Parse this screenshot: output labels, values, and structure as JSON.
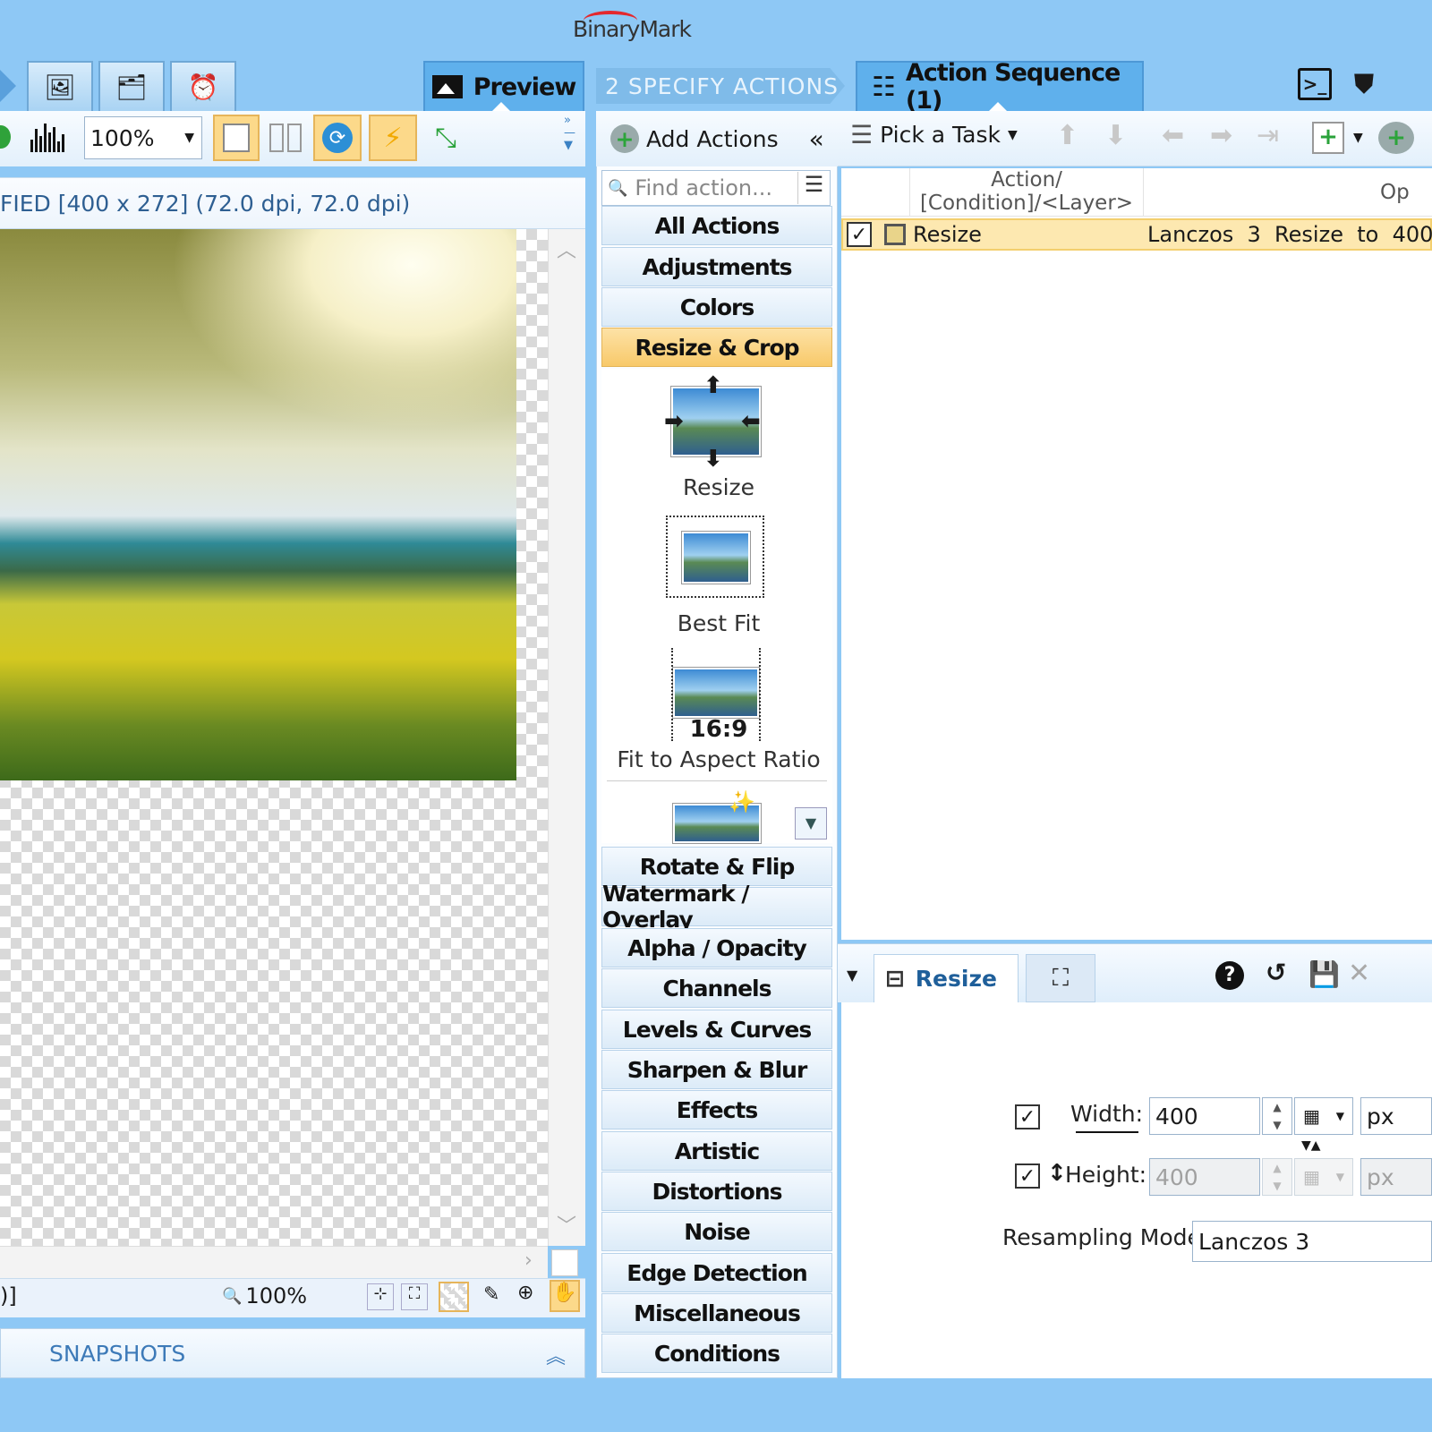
{
  "app": {
    "brand": "BinaryMark"
  },
  "tabs": {
    "preview": "Preview",
    "step2": "2  SPECIFY ACTIONS",
    "action_sequence": "Action Sequence (1)"
  },
  "left_toolbar": {
    "zoom_value": "100%"
  },
  "image_info": "FIED [400 x 272] (72.0 dpi, 72.0 dpi)",
  "status_bar": {
    "left_fragment": ")]",
    "zoom": "100%"
  },
  "snapshots": {
    "label": "SNAPSHOTS"
  },
  "actions_panel": {
    "add_actions": "Add Actions",
    "search_placeholder": "Find action...",
    "categories_top": [
      "All Actions",
      "Adjustments",
      "Colors",
      "Resize & Crop"
    ],
    "resize_items": [
      "Resize",
      "Best Fit",
      "Fit to Aspect Ratio"
    ],
    "aspect_ratio_label": "16:9",
    "categories_bottom": [
      "Rotate & Flip",
      "Watermark / Overlay",
      "Alpha / Opacity",
      "Channels",
      "Levels & Curves",
      "Sharpen & Blur",
      "Effects",
      "Artistic",
      "Distortions",
      "Noise",
      "Edge Detection",
      "Miscellaneous",
      "Conditions"
    ]
  },
  "sequence": {
    "pick_task": "Pick a Task",
    "col_action_line1": "Action/",
    "col_action_line2": "[Condition]/<Layer>",
    "col_options": "Op",
    "rows": [
      {
        "name": "Resize",
        "options": "Lanczos  3  Resize  to  400"
      }
    ]
  },
  "settings": {
    "tab_resize": "Resize",
    "width_label": "Width:",
    "width_value": "400",
    "width_unit": "px",
    "height_label": "Height:",
    "height_value": "400",
    "height_unit": "px",
    "resampling_label": "Resampling Mode:",
    "resampling_value": "Lanczos 3"
  }
}
